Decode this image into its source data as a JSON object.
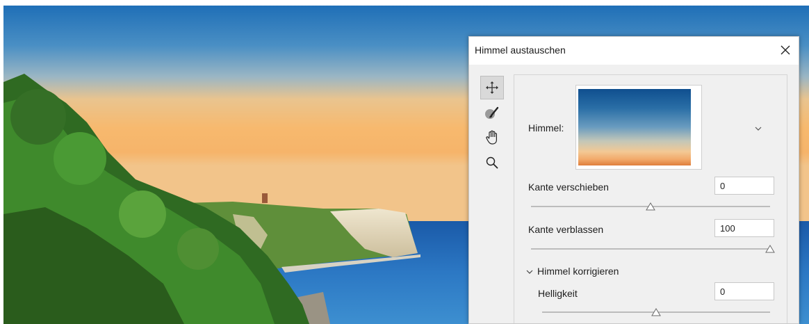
{
  "dialog": {
    "title": "Himmel austauschen",
    "close_icon": "close-icon"
  },
  "tools": [
    {
      "name": "move-tool",
      "icon": "move-icon",
      "active": true
    },
    {
      "name": "sky-brush-tool",
      "icon": "brush-icon",
      "active": false
    },
    {
      "name": "hand-tool",
      "icon": "hand-icon",
      "active": false
    },
    {
      "name": "zoom-tool",
      "icon": "zoom-icon",
      "active": false
    }
  ],
  "panel": {
    "sky_label": "Himmel:",
    "shift_edge": {
      "label": "Kante verschieben",
      "value": "0",
      "slider_fraction": 0.5
    },
    "fade_edge": {
      "label": "Kante verblassen",
      "value": "100",
      "slider_fraction": 1.0
    },
    "section": {
      "label": "Himmel korrigieren",
      "expanded": true
    },
    "brightness": {
      "label": "Helligkeit",
      "value": "0",
      "slider_fraction": 0.5
    }
  },
  "colors": {
    "dialog_bg": "#f0f0f0",
    "sky_gradient_top": "#0f4f8f",
    "sky_gradient_bottom": "#de7e3c"
  }
}
